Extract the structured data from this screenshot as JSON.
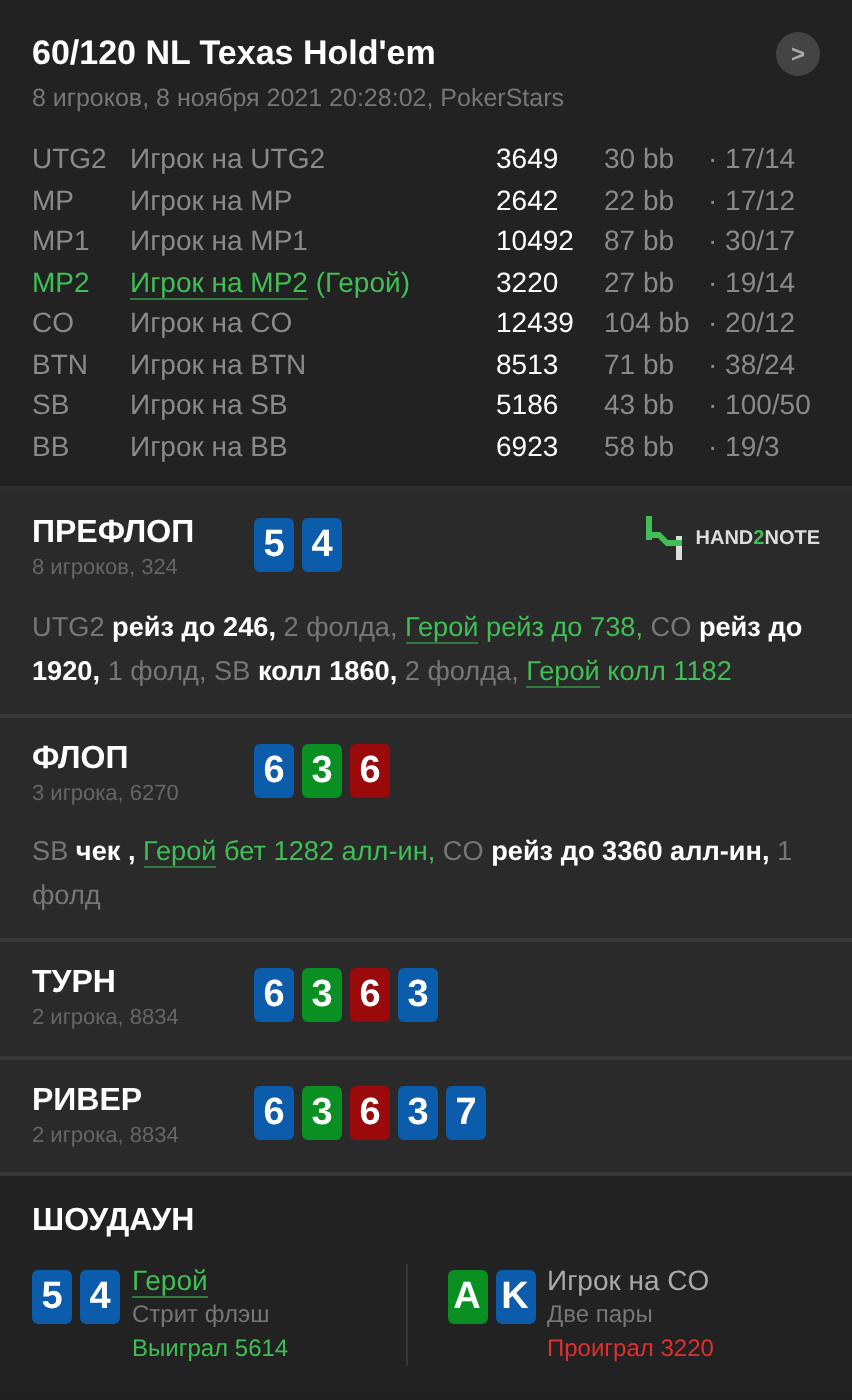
{
  "header": {
    "title": "60/120 NL Texas Hold'em",
    "subtitle": "8 игроков, 8 ноября 2021 20:28:02, PokerStars",
    "next_button": ">"
  },
  "players": [
    {
      "position": "UTG2",
      "name": "Игрок на UTG2",
      "stack": "3649",
      "bb": "30 bb",
      "stats": "· 17/14",
      "hero": false
    },
    {
      "position": "MP",
      "name": "Игрок на MP",
      "stack": "2642",
      "bb": "22 bb",
      "stats": "· 17/12",
      "hero": false
    },
    {
      "position": "MP1",
      "name": "Игрок на MP1",
      "stack": "10492",
      "bb": "87 bb",
      "stats": "· 30/17",
      "hero": false
    },
    {
      "position": "MP2",
      "name": "Игрок на MP2",
      "name_suffix": "(Герой)",
      "stack": "3220",
      "bb": "27 bb",
      "stats": "· 19/14",
      "hero": true
    },
    {
      "position": "CO",
      "name": "Игрок на CO",
      "stack": "12439",
      "bb": "104 bb",
      "stats": "· 20/12",
      "hero": false
    },
    {
      "position": "BTN",
      "name": "Игрок на BTN",
      "stack": "8513",
      "bb": "71 bb",
      "stats": "· 38/24",
      "hero": false
    },
    {
      "position": "SB",
      "name": "Игрок на SB",
      "stack": "5186",
      "bb": "43 bb",
      "stats": "· 100/50",
      "hero": false
    },
    {
      "position": "BB",
      "name": "Игрок на BB",
      "stack": "6923",
      "bb": "58 bb",
      "stats": "· 19/3",
      "hero": false
    }
  ],
  "streets": [
    {
      "title": "ПРЕФЛОП",
      "info": "8 игроков, 324",
      "logo": {
        "part_1": "HAND",
        "accent": "2",
        "part_2": "NOTE"
      },
      "cards": [
        {
          "rank": "5",
          "color": "#0b5cab"
        },
        {
          "rank": "4",
          "color": "#0b5cab"
        }
      ],
      "actions": [
        {
          "text": "UTG2",
          "kind": "player"
        },
        {
          "text": "рейз до 246,",
          "kind": "action"
        },
        {
          "text": "2 фолда,",
          "kind": "muted"
        },
        {
          "text": "Герой",
          "kind": "hero"
        },
        {
          "text": "рейз до 738,",
          "kind": "hero_action"
        },
        {
          "text": "CO",
          "kind": "player"
        },
        {
          "text": "рейз до 1920,",
          "kind": "action"
        },
        {
          "text": "1 фолд,",
          "kind": "muted"
        },
        {
          "text": "SB",
          "kind": "player"
        },
        {
          "text": "колл 1860,",
          "kind": "action"
        },
        {
          "text": "2 фолда,",
          "kind": "muted"
        },
        {
          "text": "Герой",
          "kind": "hero"
        },
        {
          "text": "колл 1182",
          "kind": "hero_action"
        }
      ]
    },
    {
      "title": "ФЛОП",
      "info": "3 игрока, 6270",
      "cards": [
        {
          "rank": "6",
          "color": "#0b5cab"
        },
        {
          "rank": "3",
          "color": "#0a8f22"
        },
        {
          "rank": "6",
          "color": "#9a0a0a"
        }
      ],
      "actions": [
        {
          "text": "SB",
          "kind": "player"
        },
        {
          "text": "чек ,",
          "kind": "action"
        },
        {
          "text": "Герой",
          "kind": "hero"
        },
        {
          "text": "бет 1282 алл-ин,",
          "kind": "hero_action"
        },
        {
          "text": "CO",
          "kind": "player"
        },
        {
          "text": "рейз до 3360 алл-ин,",
          "kind": "action"
        },
        {
          "text": "1 фолд",
          "kind": "muted"
        }
      ]
    },
    {
      "title": "ТУРН",
      "info": "2 игрока, 8834",
      "cards": [
        {
          "rank": "6",
          "color": "#0b5cab"
        },
        {
          "rank": "3",
          "color": "#0a8f22"
        },
        {
          "rank": "6",
          "color": "#9a0a0a"
        },
        {
          "rank": "3",
          "color": "#0b5cab"
        }
      ]
    },
    {
      "title": "РИВЕР",
      "info": "2 игрока, 8834",
      "cards": [
        {
          "rank": "6",
          "color": "#0b5cab"
        },
        {
          "rank": "3",
          "color": "#0a8f22"
        },
        {
          "rank": "6",
          "color": "#9a0a0a"
        },
        {
          "rank": "3",
          "color": "#0b5cab"
        },
        {
          "rank": "7",
          "color": "#0b5cab"
        }
      ]
    }
  ],
  "showdown": {
    "title": "ШОУДАУН",
    "players": [
      {
        "name": "Герой",
        "hero": true,
        "hand": "Стрит флэш",
        "result": "Выиграл 5614",
        "won": true,
        "cards": [
          {
            "rank": "5",
            "color": "#0b5cab"
          },
          {
            "rank": "4",
            "color": "#0b5cab"
          }
        ]
      },
      {
        "name": "Игрок на CO",
        "hero": false,
        "hand": "Две пары",
        "result": "Проиграл 3220",
        "won": false,
        "cards": [
          {
            "rank": "A",
            "color": "#0a8f22"
          },
          {
            "rank": "K",
            "color": "#0b5cab"
          }
        ]
      }
    ]
  }
}
